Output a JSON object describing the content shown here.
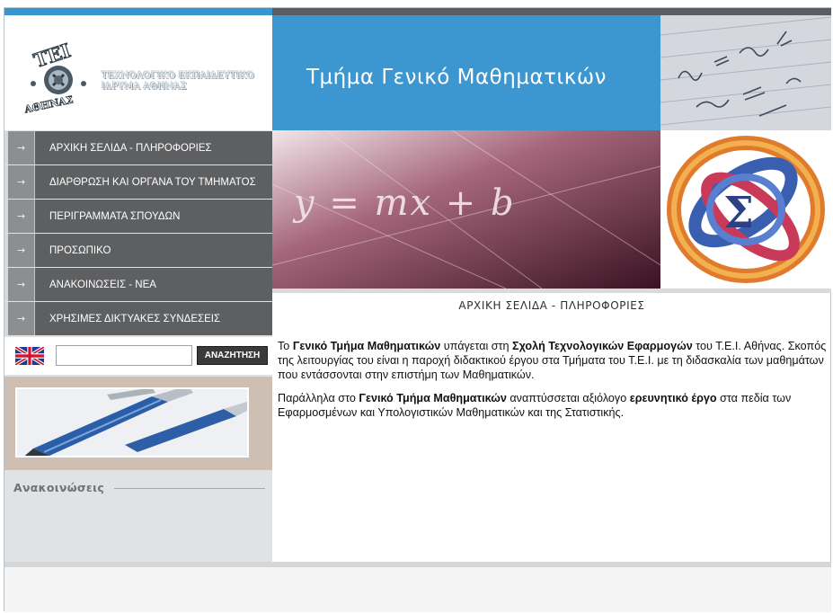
{
  "logo": {
    "emblem_text_top": "ΤΕΙ",
    "emblem_text_bottom": "ΑΘΗΝΑΣ",
    "line1": "ΤΕΧΝΟΛΟΓΙΚΟ ΕΚΠΑΙΔΕΥΤΙΚΟ",
    "line2": "ΙΔΡΥΜΑ ΑΘΗΝΑΣ"
  },
  "header": {
    "title": "Τμήμα Γενικό Μαθηματικών"
  },
  "banner": {
    "equation": "y = mx + b"
  },
  "menu": [
    {
      "label": "ΑΡΧΙΚΗ ΣΕΛΙΔΑ - ΠΛΗΡΟΦΟΡΙΕΣ"
    },
    {
      "label": "ΔΙΑΡΘΡΩΣΗ ΚΑΙ ΟΡΓΑΝΑ ΤΟΥ ΤΜΗΜΑΤΟΣ"
    },
    {
      "label": "ΠΕΡΙΓΡΑΜΜΑΤΑ ΣΠΟΥΔΩΝ"
    },
    {
      "label": "ΠΡΟΣΩΠΙΚΟ"
    },
    {
      "label": "ΑΝΑΚΟΙΝΩΣΕΙΣ - ΝΕΑ"
    },
    {
      "label": "ΧΡΗΣΙΜΕΣ ΔΙΚΤΥΑΚΕΣ ΣΥΝΔΕΣΕΙΣ"
    }
  ],
  "menu_arrow": "→",
  "search": {
    "value": "",
    "button_label": "ΑΝΑΖΗΤΗΣΗ"
  },
  "announcements": {
    "title": "Ανακοινώσεις"
  },
  "page": {
    "title": "ΑΡΧΙΚΗ ΣΕΛΙΔΑ - ΠΛΗΡΟΦΟΡΙΕΣ",
    "p1": {
      "a": "Το ",
      "b": "Γενικό Τμήμα Μαθηματικών",
      "c": " υπάγεται στη ",
      "d": "Σχολή Τεχνολογικών Εφαρμογών",
      "e": " του Τ.Ε.Ι. Αθήνας. Σκοπός της λειτουργίας  του είναι η παροχή διδακτικού έργου στα Τμήματα του Τ.Ε.Ι. με τη διδασκαλία των μαθημάτων που εντάσσονται στην επιστήμη των Μαθηματικών."
    },
    "p2": {
      "a": "Παράλληλα στο ",
      "b": "Γενικό Τμήμα Μαθηματικών",
      "c": " αναπτύσσεται αξιόλογο ",
      "d": "ερευνητικό έργο",
      "e": " στα πεδία των Εφαρμοσμένων και Υπολογιστικών Μαθηματικών και  της Στατιστικής."
    }
  },
  "colors": {
    "accent_blue": "#3c96cf",
    "menu_bg": "#5e5f61",
    "sidebar_bg": "#e1e2e4"
  }
}
